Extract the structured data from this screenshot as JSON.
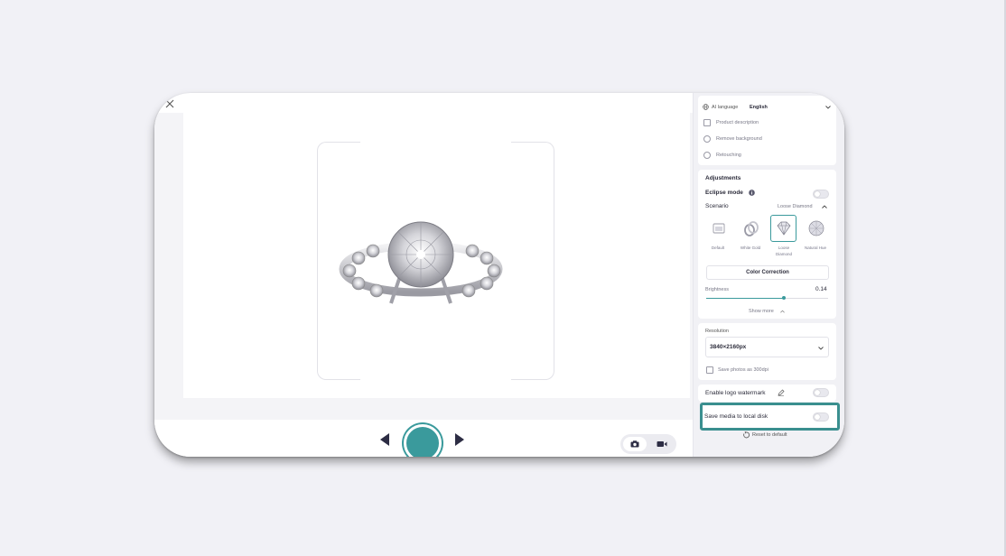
{
  "ai_language": {
    "label": "AI language",
    "value": "English"
  },
  "ai_options": [
    {
      "label": "Product description",
      "kind": "checkbox"
    },
    {
      "label": "Remove background",
      "kind": "radio"
    },
    {
      "label": "Retouching",
      "kind": "radio"
    }
  ],
  "adjustments": {
    "title": "Adjustments",
    "eclipse_label": "Eclipse mode",
    "scenario_label": "Scenario",
    "scenario_value": "Loose Diamond",
    "scenarios": [
      {
        "label": "Default"
      },
      {
        "label": "White Gold"
      },
      {
        "label": "Loose Diamond"
      },
      {
        "label": "Natural Hue"
      }
    ],
    "color_correction": "Color Correction",
    "brightness_label": "Brightness",
    "brightness_value": "0.14",
    "brightness_fraction": 0.64,
    "show_more": "Show more"
  },
  "resolution": {
    "title": "Resolution",
    "value": "3840×2160px",
    "save_300dpi": "Save photos as 300dpi"
  },
  "logo_watermark": "Enable logo watermark",
  "save_local": "Save media to local disk",
  "reset": "Reset to default",
  "colors": {
    "accent": "#3a9a9c",
    "highlight": "#3a8f8f",
    "background": "#f1f1f6"
  }
}
